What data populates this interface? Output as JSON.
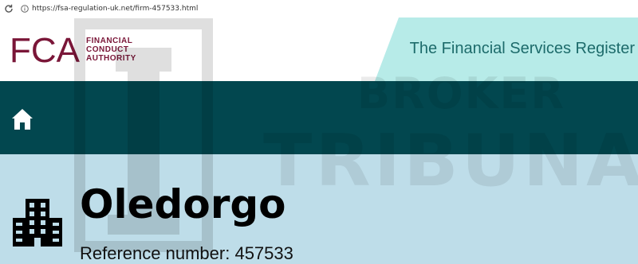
{
  "browser": {
    "url": "https://fsa-regulation-uk.net/firm-457533.html",
    "reload_icon": "reload-icon",
    "info_icon": "info-icon"
  },
  "header": {
    "logo_mark": "FCA",
    "logo_lines": [
      "FINANCIAL",
      "CONDUCT",
      "AUTHORITY"
    ],
    "register_title": "The Financial Services Register",
    "brand_color": "#7a1638",
    "accent_color": "#b7ebe8"
  },
  "nav": {
    "home_icon": "home-icon",
    "band_color": "#02474f"
  },
  "watermark": {
    "line1": "BROKER",
    "line2": "TRIBUNAL"
  },
  "firm": {
    "icon": "building-icon",
    "name": "Oledorgo",
    "reference_label": "Reference number:",
    "reference_number": "457533",
    "background_color": "#bedde9"
  }
}
